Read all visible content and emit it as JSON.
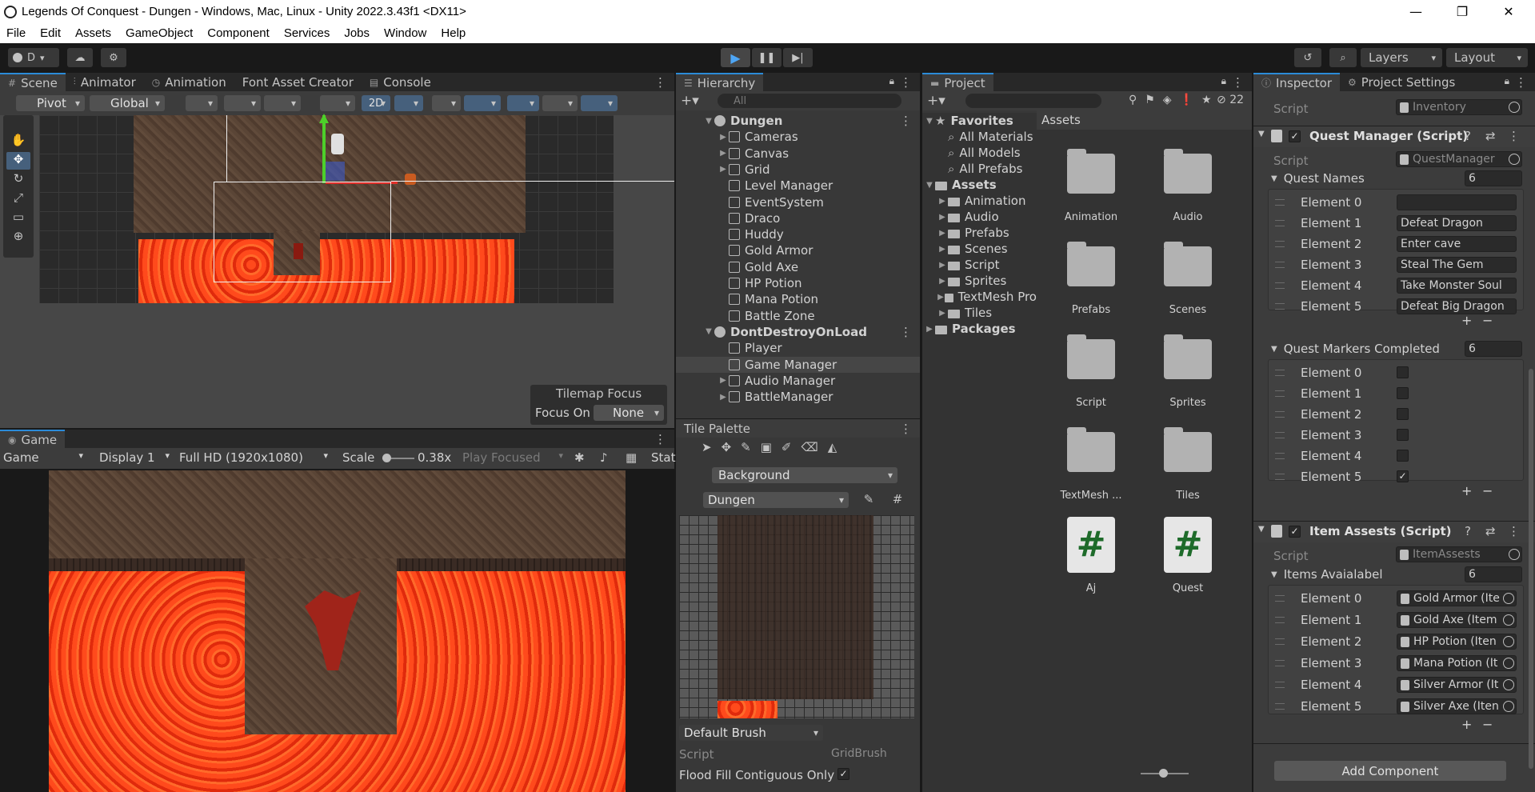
{
  "window": {
    "title": "Legends Of Conquest - Dungen - Windows, Mac, Linux - Unity 2022.3.43f1 <DX11>"
  },
  "menu": [
    "File",
    "Edit",
    "Assets",
    "GameObject",
    "Component",
    "Services",
    "Jobs",
    "Window",
    "Help"
  ],
  "toolbar": {
    "account": "D",
    "layers": "Layers",
    "layout": "Layout"
  },
  "scene": {
    "tabs": [
      "Scene",
      "Animator",
      "Animation",
      "Font Asset Creator",
      "Console"
    ],
    "pivot": "Pivot",
    "global": "Global",
    "mode_2d": "2D",
    "tilemap_focus_title": "Tilemap Focus",
    "focus_on_label": "Focus On",
    "focus_on_value": "None"
  },
  "game": {
    "tab": "Game",
    "display_mode": "Game",
    "display": "Display 1",
    "resolution": "Full HD (1920x1080)",
    "scale_label": "Scale",
    "scale_value": "0.38x",
    "play_mode": "Play Focused",
    "stats": "Stat"
  },
  "hierarchy": {
    "tab": "Hierarchy",
    "search_placeholder": "All",
    "items": [
      {
        "label": "Dungen",
        "kind": "scene"
      },
      {
        "label": "Cameras",
        "kind": "child-arrow"
      },
      {
        "label": "Canvas",
        "kind": "child-arrow"
      },
      {
        "label": "Grid",
        "kind": "child-arrow"
      },
      {
        "label": "Level Manager",
        "kind": "child"
      },
      {
        "label": "EventSystem",
        "kind": "child"
      },
      {
        "label": "Draco",
        "kind": "child"
      },
      {
        "label": "Huddy",
        "kind": "child"
      },
      {
        "label": "Gold Armor",
        "kind": "child"
      },
      {
        "label": "Gold Axe",
        "kind": "child"
      },
      {
        "label": "HP Potion",
        "kind": "child"
      },
      {
        "label": "Mana Potion",
        "kind": "child"
      },
      {
        "label": "Battle Zone",
        "kind": "child"
      },
      {
        "label": "DontDestroyOnLoad",
        "kind": "scene"
      },
      {
        "label": "Player",
        "kind": "child"
      },
      {
        "label": "Game Manager",
        "kind": "child-selected"
      },
      {
        "label": "Audio Manager",
        "kind": "child-arrow"
      },
      {
        "label": "BattleManager",
        "kind": "child-arrow"
      }
    ]
  },
  "tile_palette": {
    "tab": "Tile Palette",
    "layer": "Background",
    "palette": "Dungen",
    "brush": "Default Brush",
    "script_label": "Script",
    "script_value": "GridBrush",
    "flood_fill_label": "Flood Fill Contiguous Only"
  },
  "project": {
    "tab": "Project",
    "count": "22",
    "tree": [
      {
        "label": "Favorites",
        "level": 0,
        "type": "star"
      },
      {
        "label": "All Materials",
        "level": 1,
        "type": "search"
      },
      {
        "label": "All Models",
        "level": 1,
        "type": "search"
      },
      {
        "label": "All Prefabs",
        "level": 1,
        "type": "search"
      },
      {
        "label": "Assets",
        "level": 0,
        "type": "folder"
      },
      {
        "label": "Animation",
        "level": 1,
        "type": "folder"
      },
      {
        "label": "Audio",
        "level": 1,
        "type": "folder"
      },
      {
        "label": "Prefabs",
        "level": 1,
        "type": "folder"
      },
      {
        "label": "Scenes",
        "level": 1,
        "type": "folder"
      },
      {
        "label": "Script",
        "level": 1,
        "type": "folder"
      },
      {
        "label": "Sprites",
        "level": 1,
        "type": "folder"
      },
      {
        "label": "TextMesh Pro",
        "level": 1,
        "type": "folder"
      },
      {
        "label": "Tiles",
        "level": 1,
        "type": "folder"
      },
      {
        "label": "Packages",
        "level": 0,
        "type": "folder"
      }
    ],
    "breadcrumb": "Assets",
    "assets": [
      {
        "label": "Animation",
        "type": "folder"
      },
      {
        "label": "Audio",
        "type": "folder"
      },
      {
        "label": "Prefabs",
        "type": "folder"
      },
      {
        "label": "Scenes",
        "type": "folder"
      },
      {
        "label": "Script",
        "type": "folder"
      },
      {
        "label": "Sprites",
        "type": "folder"
      },
      {
        "label": "TextMesh ...",
        "type": "folder"
      },
      {
        "label": "Tiles",
        "type": "folder"
      },
      {
        "label": "Aj",
        "type": "script"
      },
      {
        "label": "Quest",
        "type": "script"
      }
    ]
  },
  "inspector": {
    "tabs": [
      "Inspector",
      "Project Settings"
    ],
    "top_script_label": "Script",
    "top_script_value": "Inventory",
    "quest_manager": {
      "title": "Quest Manager (Script)",
      "script_label": "Script",
      "script_value": "QuestManager",
      "names_label": "Quest Names",
      "names_count": "6",
      "names": [
        {
          "label": "Element 0",
          "value": ""
        },
        {
          "label": "Element 1",
          "value": "Defeat Dragon"
        },
        {
          "label": "Element 2",
          "value": "Enter cave"
        },
        {
          "label": "Element 3",
          "value": "Steal The Gem"
        },
        {
          "label": "Element 4",
          "value": "Take Monster Soul"
        },
        {
          "label": "Element 5",
          "value": "Defeat Big Dragon"
        }
      ],
      "markers_label": "Quest Markers Completed",
      "markers_count": "6",
      "markers": [
        {
          "label": "Element 0",
          "checked": ""
        },
        {
          "label": "Element 1",
          "checked": ""
        },
        {
          "label": "Element 2",
          "checked": ""
        },
        {
          "label": "Element 3",
          "checked": ""
        },
        {
          "label": "Element 4",
          "checked": ""
        },
        {
          "label": "Element 5",
          "checked": "✓"
        }
      ]
    },
    "item_assets": {
      "title": "Item Assests (Script)",
      "script_label": "Script",
      "script_value": "ItemAssests",
      "items_label": "Items Avaialabel",
      "items_count": "6",
      "items": [
        {
          "label": "Element 0",
          "value": "Gold Armor (Ite"
        },
        {
          "label": "Element 1",
          "value": "Gold Axe (Item"
        },
        {
          "label": "Element 2",
          "value": "HP Potion (Iten"
        },
        {
          "label": "Element 3",
          "value": "Mana Potion (It"
        },
        {
          "label": "Element 4",
          "value": "Silver Armor (It"
        },
        {
          "label": "Element 5",
          "value": "Silver Axe (Iten"
        }
      ]
    },
    "add_component": "Add Component"
  }
}
